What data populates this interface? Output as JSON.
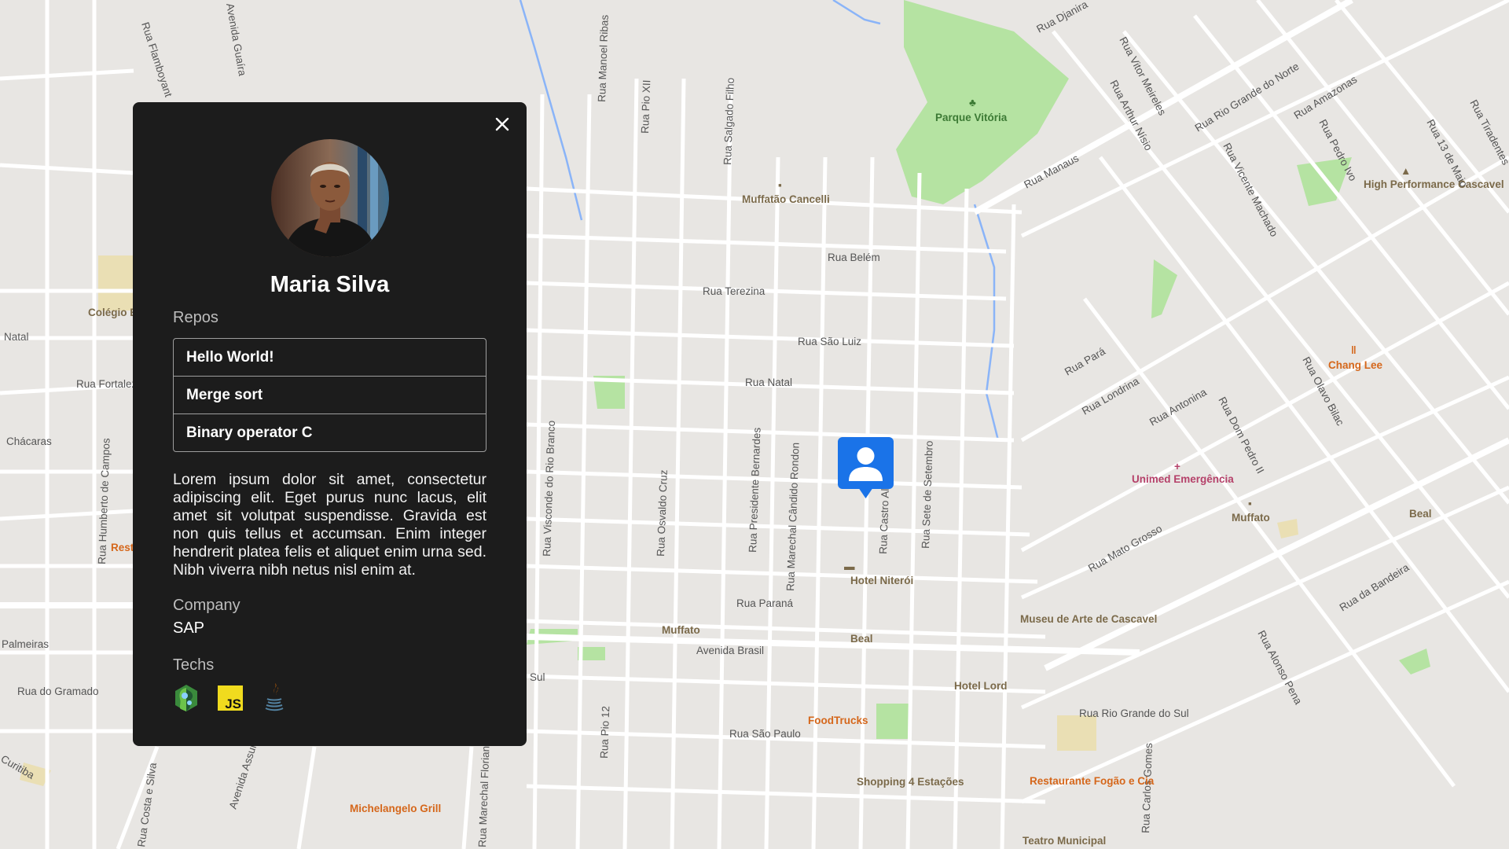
{
  "map": {
    "street_labels": [
      "Rua Flamboyant",
      "Avenida Guaíra",
      "Rua Manoel Ribas",
      "Rua Pio XII",
      "Rua Salgado Filho",
      "Rua Djanira",
      "Rua Vitor Meireles",
      "Rua Arthur Nísio",
      "Rua Rio Grande do Norte",
      "Rua Amazonas",
      "Rua 13 de Maio",
      "Rua Tiradentes",
      "Rua Pedro Ivo",
      "Rua Manaus",
      "Rua Vicente Machado",
      "Rua Belém",
      "Rua Terezina",
      "Rua São Luiz",
      "Rua Natal",
      "Rua Pará",
      "Rua Londrina",
      "Rua Antonina",
      "Rua Dom Pedro II",
      "Rua Olavo Bilac",
      "Rua Mato Grosso",
      "Rua Visconde do Rio Branco",
      "Rua Osvaldo Cruz",
      "Rua Presidente Bernardes",
      "Rua Marechal Cândido Rondon",
      "Rua Castro Alves",
      "Rua Sete de Setembro",
      "Rua Paraná",
      "Avenida Brasil",
      "Rua da Bandeira",
      "Rua Alonso Pena",
      "Rua Rio Grande do Sul",
      "Rua São Paulo",
      "Rua Carlos Gomes",
      "Rua Pio 12",
      "Rua do Gramado",
      "Palmeiras",
      "Chácaras",
      "Rua Fortaleza",
      "Natal",
      "Rua Humberto de Campos",
      "Rua Marechal Floriano",
      "Rua Costa e Silva",
      "Curitiba",
      "Avenida Assunção",
      "Sul"
    ],
    "places": [
      {
        "name": "Parque Vitória",
        "icon": "tree-icon"
      },
      {
        "name": "Muffatão Cancelli",
        "icon": "shopping-icon"
      },
      {
        "name": "High Performance Cascavel",
        "icon": "school-icon"
      },
      {
        "name": "Colégio Estadual Polivalente Boaretto",
        "icon": "school-icon"
      },
      {
        "name": "Chang Lee",
        "icon": "restaurant-icon"
      },
      {
        "name": "Unimed Emergência",
        "icon": "hospital-icon"
      },
      {
        "name": "Muffato",
        "icon": "shopping-icon"
      },
      {
        "name": "Beal",
        "icon": "shopping-icon"
      },
      {
        "name": "Hotel Niterói",
        "icon": "hotel-icon"
      },
      {
        "name": "Museu de Arte de Cascavel",
        "icon": "museum-icon"
      },
      {
        "name": "Hotel Lord",
        "icon": "hotel-icon"
      },
      {
        "name": "FoodTrucks",
        "icon": "restaurant-icon"
      },
      {
        "name": "Shopping 4 Estações",
        "icon": "shopping-icon"
      },
      {
        "name": "Restaurante Fogão e Cia",
        "icon": "restaurant-icon"
      },
      {
        "name": "Teatro Municipal",
        "icon": "theater-icon"
      },
      {
        "name": "Michelangelo Grill",
        "icon": "restaurant-icon"
      },
      {
        "name": "Restaurante",
        "icon": "restaurant-icon"
      }
    ],
    "colors": {
      "background": "#e8e6e3",
      "road": "#ffffff",
      "park": "#b5e3a2",
      "water": "#8ab4f8",
      "marker": "#1a73e8",
      "food": "#d5671b",
      "hospital": "#b5416a",
      "poi": "#7b6a4a"
    }
  },
  "profile": {
    "name": "Maria Silva",
    "repos_label": "Repos",
    "repos": [
      "Hello World!",
      "Merge sort",
      "Binary operator C"
    ],
    "bio": "Lorem ipsum dolor sit amet, consectetur adipiscing elit. Eget purus nunc lacus, elit amet sit volutpat suspendisse. Gravida est non quis tellus et accumsan. Enim integer hendrerit platea felis et aliquet enim urna sed. Nibh viverra nibh netus nisl enim at.",
    "company_label": "Company",
    "company": "SAP",
    "techs_label": "Techs",
    "techs": [
      {
        "name": "node",
        "icon": "nodejs-icon"
      },
      {
        "name": "JS",
        "icon": "javascript-icon"
      },
      {
        "name": "java",
        "icon": "java-icon"
      }
    ]
  }
}
